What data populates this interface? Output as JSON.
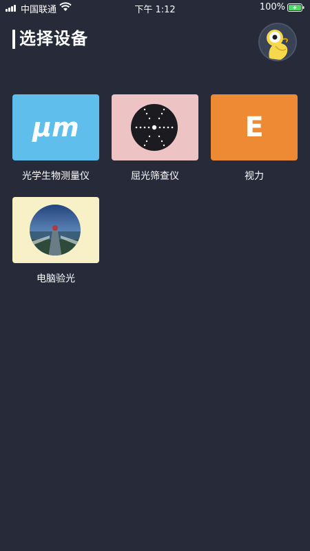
{
  "status_bar": {
    "carrier": "中国联通",
    "time": "下午 1:12",
    "battery_percent": "100%"
  },
  "header": {
    "title": "选择设备"
  },
  "devices": [
    {
      "label": "光学生物测量仪",
      "tile_text": "μm",
      "tile_color": "#5fbeeb",
      "icon": "um-text-icon"
    },
    {
      "label": "屈光筛查仪",
      "tile_color": "#eec3c4",
      "icon": "refraction-dial-icon"
    },
    {
      "label": "视力",
      "tile_text": "E",
      "tile_color": "#ee8a34",
      "icon": "e-chart-icon"
    },
    {
      "label": "电脑验光",
      "tile_color": "#f8f1c7",
      "icon": "eye-scene-icon"
    }
  ],
  "colors": {
    "background": "#262a39",
    "text": "#ffffff"
  }
}
